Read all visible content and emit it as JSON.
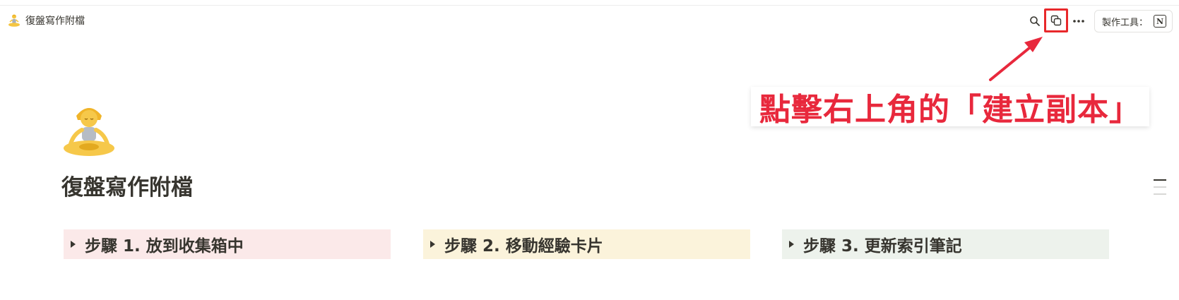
{
  "breadcrumb": {
    "title": "復盤寫作附檔",
    "icon": "person-in-lotus-position-emoji"
  },
  "topbar": {
    "search_icon": "search-icon",
    "duplicate_icon": "duplicate-icon",
    "more_icon": "more-horizontal-icon",
    "made_with_label": "製作工具：",
    "made_with_logo": "notion-logo-icon"
  },
  "annotation": {
    "text": "點擊右上角的「建立副本」",
    "color": "#e8283c"
  },
  "page": {
    "icon": "person-in-lotus-position-emoji",
    "title": "復盤寫作附檔",
    "toggles": [
      {
        "label": "步驟 1. 放到收集箱中",
        "color": "#fbe9e9"
      },
      {
        "label": "步驟 2. 移動經驗卡片",
        "color": "#fbf3db"
      },
      {
        "label": "步驟 3. 更新索引筆記",
        "color": "#edf2ec"
      }
    ]
  }
}
